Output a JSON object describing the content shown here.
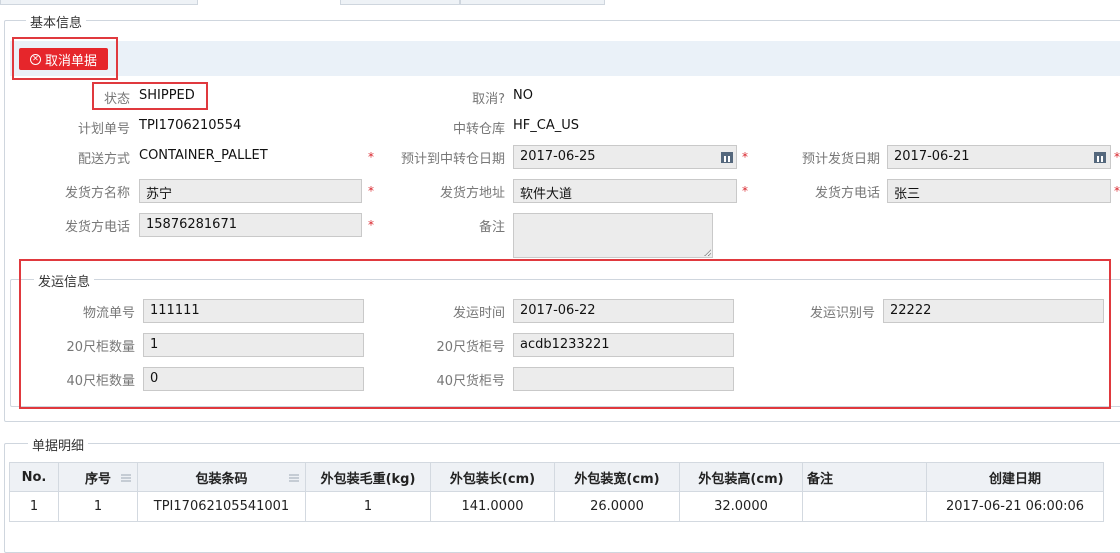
{
  "section_basic": {
    "legend": "基本信息",
    "cancel_button": "取消单据",
    "fields": {
      "status_label": "状态",
      "status_value": "SHIPPED",
      "cancelled_label": "取消?",
      "cancelled_value": "NO",
      "plan_no_label": "计划单号",
      "plan_no_value": "TPI1706210554",
      "transit_wh_label": "中转仓库",
      "transit_wh_value": "HF_CA_US",
      "delivery_method_label": "配送方式",
      "delivery_method_value": "CONTAINER_PALLET",
      "eta_transit_label": "预计到中转仓日期",
      "eta_transit_value": "2017-06-25",
      "est_ship_date_label": "预计发货日期",
      "est_ship_date_value": "2017-06-21",
      "shipper_name_label": "发货方名称",
      "shipper_name_value": "苏宁",
      "shipper_address_label": "发货方地址",
      "shipper_address_value": "软件大道",
      "shipper_phone_label_r": "发货方电话",
      "shipper_phone_value_r": "张三",
      "shipper_phone_label": "发货方电话",
      "shipper_phone_value": "15876281671",
      "remark_label": "备注",
      "remark_value": ""
    }
  },
  "section_shipping": {
    "legend": "发运信息",
    "tracking_no_label": "物流单号",
    "tracking_no_value": "111111",
    "ship_time_label": "发运时间",
    "ship_time_value": "2017-06-22",
    "ship_id_label": "发运识别号",
    "ship_id_value": "22222",
    "c20_qty_label": "20尺柜数量",
    "c20_qty_value": "1",
    "c20_no_label": "20尺货柜号",
    "c20_no_value": "acdb1233221",
    "c40_qty_label": "40尺柜数量",
    "c40_qty_value": "0",
    "c40_no_label": "40尺货柜号",
    "c40_no_value": ""
  },
  "section_details": {
    "legend": "单据明细",
    "columns": [
      "No.",
      "序号",
      "包装条码",
      "外包装毛重(kg)",
      "外包装长(cm)",
      "外包装宽(cm)",
      "外包装高(cm)",
      "备注",
      "创建日期"
    ],
    "rows": [
      [
        "1",
        "1",
        "TPI17062105541001",
        "1",
        "141.0000",
        "26.0000",
        "32.0000",
        "",
        "2017-06-21 06:00:06"
      ]
    ]
  },
  "colors": {
    "accent_red": "#e6262b",
    "toolbar_bg": "#eaf1f8",
    "input_bg": "#ececec"
  },
  "icons": {
    "cancel": "close-circle-icon",
    "calendar": "calendar-icon",
    "column_menu": "column-menu-icon"
  }
}
